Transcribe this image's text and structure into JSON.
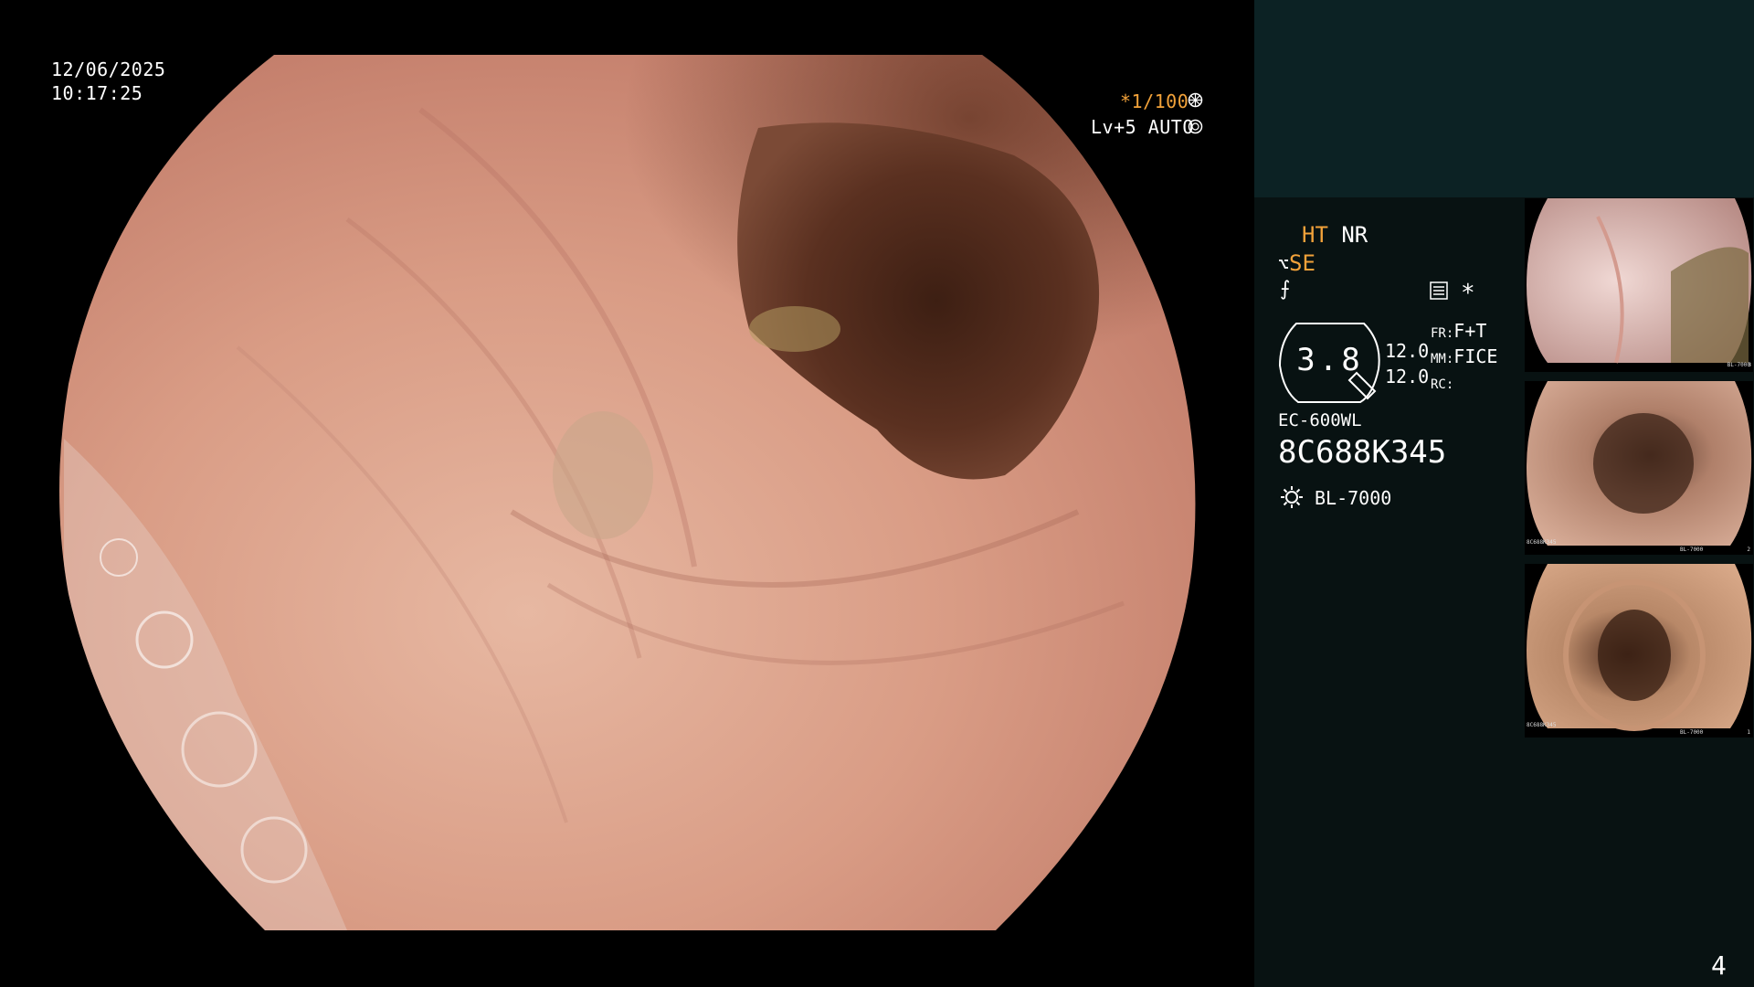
{
  "overlay": {
    "date": "12/06/2025",
    "time": "10:17:25",
    "shutter": "*1/100",
    "shutter_icon": "aperture-icon",
    "level": "Lv+5 AUTO",
    "level_icon": "iris-icon"
  },
  "panel": {
    "mode_ht": "HT",
    "mode_nr": "NR",
    "mode_se": "SE",
    "star": "*",
    "zoom_value": "3.8",
    "values": [
      "12.0",
      "12.0"
    ],
    "fr_label": "FR:",
    "fr_value": "F+T",
    "mm_label": "MM:",
    "mm_value": "FICE",
    "rc_label": "RC:",
    "rc_value": "",
    "scope_model": "EC-600WL",
    "serial": "8C688K345",
    "light_source": "BL-7000"
  },
  "thumbnails": [
    {
      "index": "3",
      "light": "BL-7000"
    },
    {
      "index": "2",
      "light": "BL-7000",
      "serial": "8C688K345"
    },
    {
      "index": "1",
      "light": "BL-7000",
      "serial": "8C688K345"
    }
  ],
  "page_number": "4",
  "colors": {
    "accent": "#f2a23a",
    "panel_bg": "#081212",
    "panel_top": "#0c2224"
  }
}
